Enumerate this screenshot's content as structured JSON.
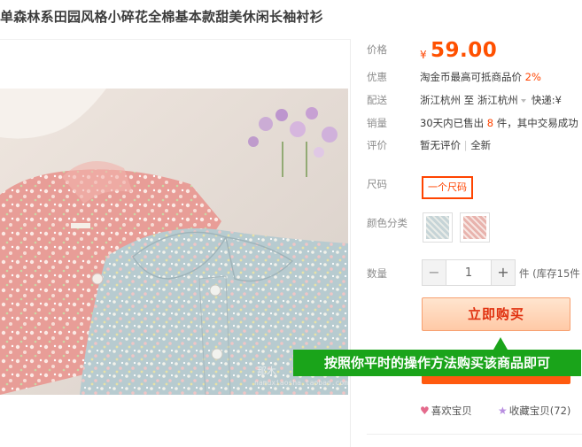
{
  "product": {
    "title": "单森林系田园风格小碎花全棉基本款甜美休闲长袖衬衫"
  },
  "image": {
    "watermark_text": "那木",
    "watermark_url": "namuxiaosha.taobao.com"
  },
  "info": {
    "price_label": "价格",
    "currency": "¥",
    "price": "59.00",
    "promo_label": "优惠",
    "promo_text": "淘金币最高可抵商品价",
    "promo_value": "2%",
    "ship_label": "配送",
    "ship_from": "浙江杭州",
    "ship_to_word": "至",
    "ship_to": "浙江杭州",
    "ship_method": "快递:¥",
    "sales_label": "销量",
    "sales_text_a": "30天内已售出",
    "sales_count": "8",
    "sales_text_b": "件，其中交易成功",
    "review_label": "评价",
    "review_text": "暂无评价",
    "review_sep": "|",
    "review_new": "全新",
    "size_label": "尺码",
    "size_option": "一个尺码",
    "color_label": "颜色分类",
    "qty_label": "数量",
    "qty_minus": "−",
    "qty_value": "1",
    "qty_plus": "+",
    "qty_stock": "件 (库存15件",
    "buy_now": "立即购买",
    "like_label": "喜欢宝贝",
    "fav_label": "收藏宝贝(72)"
  },
  "tooltip": {
    "text": "按照你平时的操作方法购买该商品即可"
  },
  "icons": {
    "heart": "heart-icon",
    "star": "star-icon",
    "dropdown": "triangle-down-icon"
  },
  "colors": {
    "accent": "#ff5000",
    "tooltip_bg": "#1aa41a",
    "buy_btn": "#ffd6b8"
  }
}
